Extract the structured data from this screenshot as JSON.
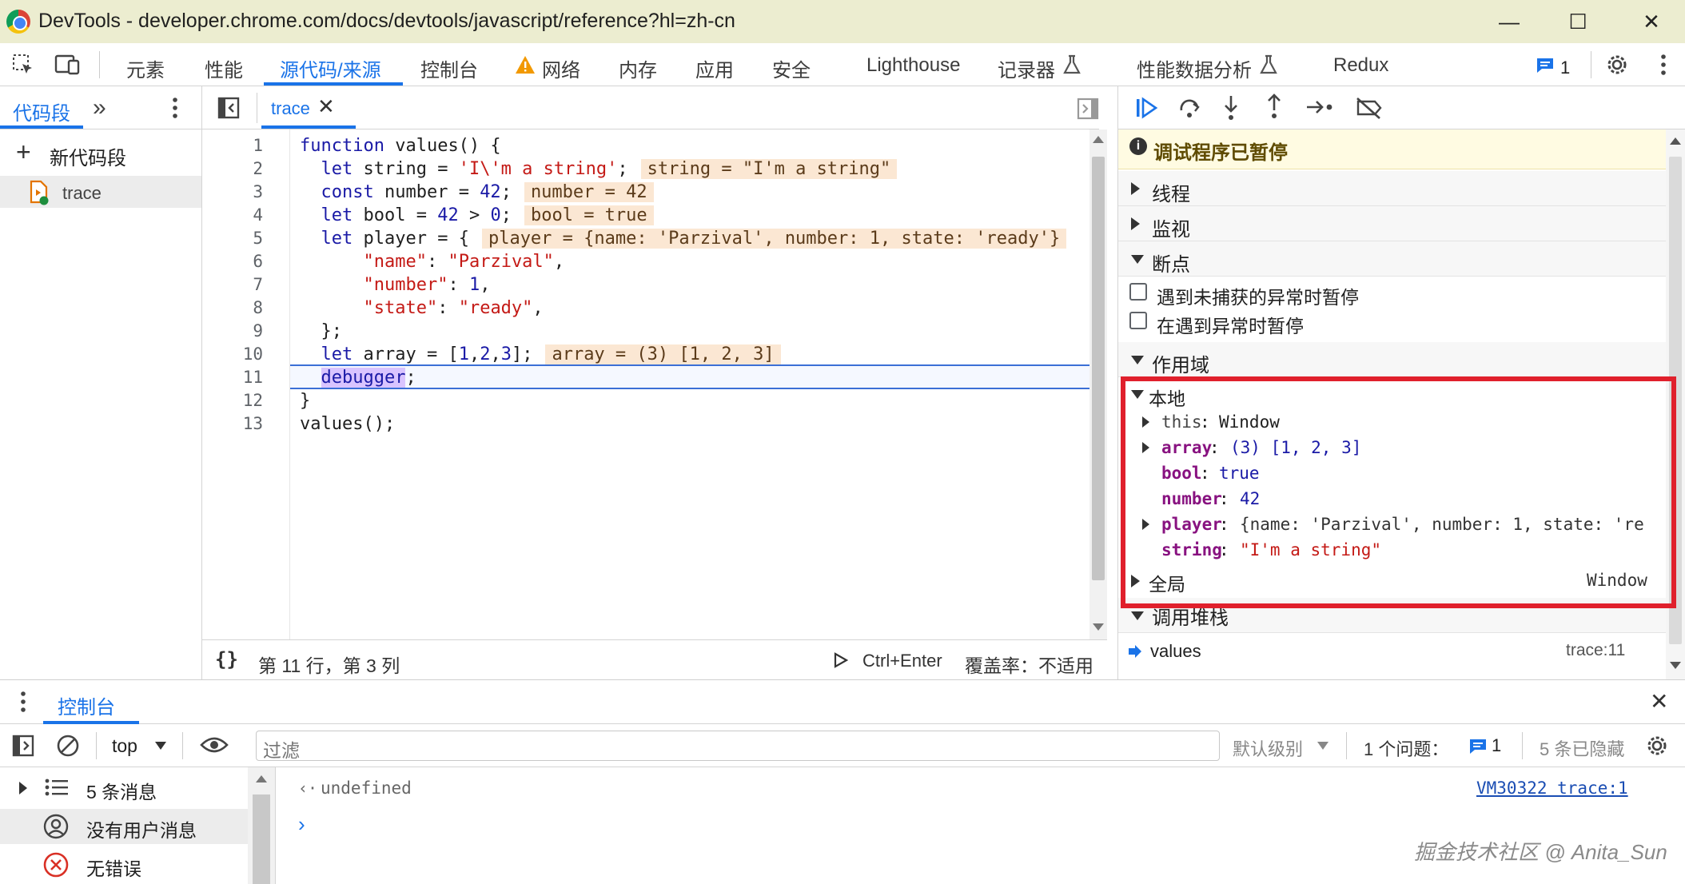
{
  "window": {
    "title": "DevTools - developer.chrome.com/docs/devtools/javascript/reference?hl=zh-cn",
    "minimize": "—",
    "maximize": "☐",
    "close": "✕"
  },
  "main_tabs": [
    "元素",
    "性能",
    "源代码/来源",
    "控制台",
    "网络",
    "内存",
    "应用",
    "安全",
    "Lighthouse",
    "记录器",
    "性能数据分析",
    "Redux"
  ],
  "active_tab": "源代码/来源",
  "issues_count": "1",
  "navigator": {
    "tab": "代码段",
    "more": "»",
    "new_snippet": "新代码段",
    "snippet": "trace"
  },
  "editor": {
    "file_tab": "trace",
    "lines": [
      "1",
      "2",
      "3",
      "4",
      "5",
      "6",
      "7",
      "8",
      "9",
      "10",
      "11",
      "12",
      "13"
    ],
    "inline_values": {
      "string": "string = \"I'm a string\"",
      "number": "number = 42",
      "bool": "bool = true",
      "player": "player = {name: 'Parzival', number: 1, state: 'ready'}",
      "array": "array = (3) [1, 2, 3]"
    },
    "status_position": "第 11 行，第 3 列",
    "run_shortcut": "Ctrl+Enter",
    "coverage": "覆盖率：不适用"
  },
  "debugger": {
    "paused": "调试程序已暂停",
    "sections": {
      "threads": "线程",
      "watch": "监视",
      "breakpoints": "断点",
      "scope": "作用域",
      "call_stack": "调用堆栈"
    },
    "checkbox_uncaught": "遇到未捕获的异常时暂停",
    "checkbox_caught": "在遇到异常时暂停",
    "scope": {
      "local": "本地",
      "global": "全局",
      "global_value": "Window",
      "this_key": "this",
      "this_value": "Window",
      "array_key": "array",
      "array_value": "(3) [1, 2, 3]",
      "bool_key": "bool",
      "bool_value": "true",
      "number_key": "number",
      "number_value": "42",
      "player_key": "player",
      "player_value": "{name: 'Parzival', number: 1, state: 're",
      "string_key": "string",
      "string_value": "\"I'm a string\""
    },
    "call_stack": {
      "frame": "values",
      "location": "trace:11"
    }
  },
  "console": {
    "drawer_tab": "控制台",
    "context": "top",
    "filter_placeholder": "过滤",
    "level": "默认级别",
    "issues_label": "1 个问题：",
    "issues_count": "1",
    "hidden": "5 条已隐藏",
    "side": {
      "messages": "5 条消息",
      "user_messages": "没有用户消息",
      "errors": "无错误"
    },
    "output_value": "undefined",
    "output_source": "VM30322 trace:1",
    "prompt": "›"
  },
  "watermark": "掘金技术社区 @ Anita_Sun",
  "colors": {
    "accent": "#1a73e8",
    "title_bar": "#ecedd0",
    "highlight_box": "#e0202c",
    "inline_value_bg": "#fbe7d3"
  }
}
